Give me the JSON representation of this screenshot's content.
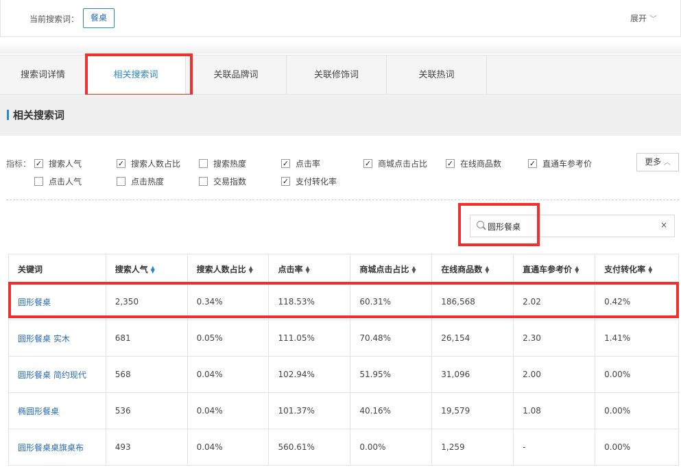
{
  "term_bar": {
    "label": "当前搜索词：",
    "tag": "餐桌",
    "expand": "展开"
  },
  "tabs": [
    "搜索词详情",
    "相关搜索词",
    "关联品牌词",
    "关联修饰词",
    "关联热词"
  ],
  "active_tab": 1,
  "section_title": "相关搜索词",
  "indicators": {
    "label": "指标：",
    "items": [
      {
        "label": "搜索人气",
        "checked": true
      },
      {
        "label": "搜索人数占比",
        "checked": true
      },
      {
        "label": "搜索热度",
        "checked": false
      },
      {
        "label": "点击率",
        "checked": true
      },
      {
        "label": "商城点击占比",
        "checked": true
      },
      {
        "label": "在线商品数",
        "checked": true
      },
      {
        "label": "直通车参考价",
        "checked": true
      },
      {
        "label": "点击人气",
        "checked": false
      },
      {
        "label": "点击热度",
        "checked": false
      },
      {
        "label": "交易指数",
        "checked": false
      },
      {
        "label": "支付转化率",
        "checked": true
      }
    ],
    "more": "更多"
  },
  "search": {
    "value": "圆形餐桌",
    "clear": "×"
  },
  "table": {
    "headers": [
      "关键词",
      "搜索人气",
      "搜索人数占比",
      "点击率",
      "商城点击占比",
      "在线商品数",
      "直通车参考价",
      "支付转化率"
    ],
    "rows": [
      [
        "圆形餐桌",
        "2,350",
        "0.34%",
        "118.53%",
        "60.31%",
        "186,568",
        "2.02",
        "0.42%"
      ],
      [
        "圆形餐桌 实木",
        "681",
        "0.05%",
        "111.05%",
        "70.48%",
        "26,154",
        "2.30",
        "1.41%"
      ],
      [
        "圆形餐桌 简约现代",
        "568",
        "0.04%",
        "102.94%",
        "51.95%",
        "31,096",
        "2.00",
        "0.00%"
      ],
      [
        "椭圆形餐桌",
        "536",
        "0.04%",
        "101.37%",
        "40.16%",
        "19,579",
        "1.08",
        "0.00%"
      ],
      [
        "圆形餐桌桌旗桌布",
        "493",
        "0.04%",
        "560.61%",
        "0.00%",
        "1,259",
        "-",
        "0.00%"
      ]
    ]
  },
  "colors": {
    "accent": "#2a87c8",
    "highlight": "#f0302e"
  }
}
